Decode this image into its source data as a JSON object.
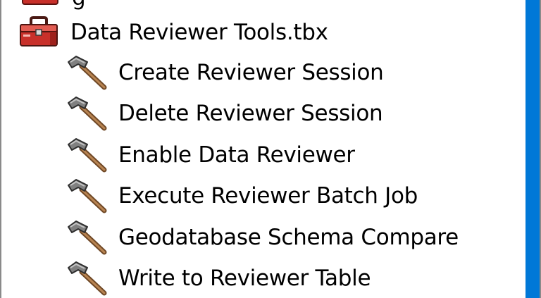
{
  "tree": {
    "toolbox": {
      "label": "Data Reviewer Tools.tbx",
      "icon": "toolbox-icon"
    },
    "tools": [
      {
        "label": "Create Reviewer Session",
        "icon": "hammer-icon"
      },
      {
        "label": "Delete Reviewer Session",
        "icon": "hammer-icon"
      },
      {
        "label": "Enable Data Reviewer",
        "icon": "hammer-icon"
      },
      {
        "label": "Execute Reviewer Batch Job",
        "icon": "hammer-icon"
      },
      {
        "label": "Geodatabase Schema Compare",
        "icon": "hammer-icon"
      },
      {
        "label": "Write to Reviewer Table",
        "icon": "hammer-icon"
      }
    ]
  },
  "colors": {
    "background": "#ffffff",
    "text": "#000000",
    "selection_strip": "#0078d7",
    "toolbox_red": "#c8302a",
    "hammer_head": "#6f6f6f",
    "hammer_handle": "#9c6b3e"
  }
}
